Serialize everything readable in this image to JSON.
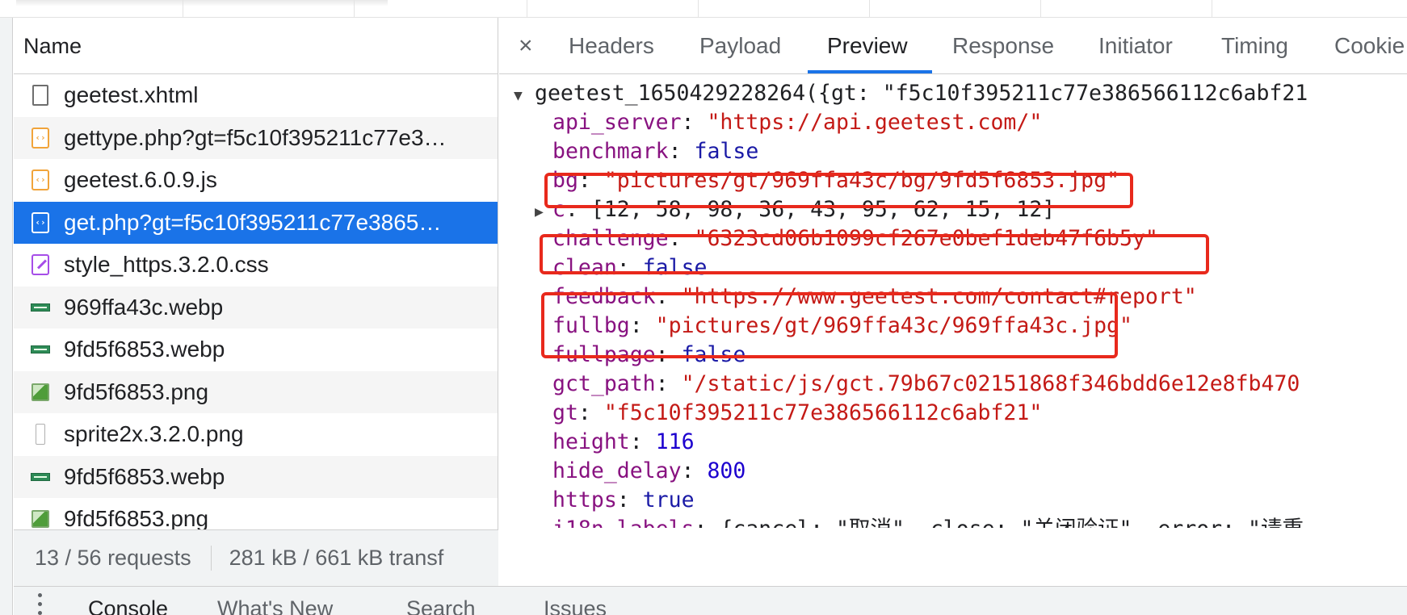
{
  "network": {
    "name_header": "Name",
    "requests": [
      {
        "name": "geetest.xhtml",
        "icon": "document-icon"
      },
      {
        "name": "gettype.php?gt=f5c10f395211c77e3…",
        "icon": "script-icon"
      },
      {
        "name": "geetest.6.0.9.js",
        "icon": "script-icon"
      },
      {
        "name": "get.php?gt=f5c10f395211c77e3865…",
        "icon": "script-icon"
      },
      {
        "name": "style_https.3.2.0.css",
        "icon": "stylesheet-icon"
      },
      {
        "name": "969ffa43c.webp",
        "icon": "webp-image-icon"
      },
      {
        "name": "9fd5f6853.webp",
        "icon": "webp-image-icon"
      },
      {
        "name": "9fd5f6853.png",
        "icon": "png-image-icon"
      },
      {
        "name": "sprite2x.3.2.0.png",
        "icon": "blank-file-icon"
      },
      {
        "name": "9fd5f6853.webp",
        "icon": "webp-image-icon"
      },
      {
        "name": "9fd5f6853.png",
        "icon": "png-image-icon"
      }
    ],
    "selected_index": 3,
    "status": {
      "requests": "13 / 56 requests",
      "transferred": "281 kB / 661 kB transf"
    }
  },
  "detail": {
    "close_symbol": "×",
    "tabs": [
      "Headers",
      "Payload",
      "Preview",
      "Response",
      "Initiator",
      "Timing",
      "Cookie"
    ],
    "active_tab": "Preview",
    "preview": {
      "root": "geetest_1650429228264({gt: \"f5c10f395211c77e386566112c6abf21",
      "lines": [
        {
          "key": "api_server",
          "value": "\"https://api.geetest.com/\"",
          "type": "string"
        },
        {
          "key": "benchmark",
          "value": "false",
          "type": "bool"
        },
        {
          "key": "bg",
          "value": "\"pictures/gt/969ffa43c/bg/9fd5f6853.jpg\"",
          "type": "string"
        },
        {
          "key": "c",
          "value": "[12, 58, 98, 36, 43, 95, 62, 15, 12]",
          "type": "array"
        },
        {
          "key": "challenge",
          "value": "\"6323cd06b1099cf267e0bef1deb47f6b5y\"",
          "type": "string"
        },
        {
          "key": "clean",
          "value": "false",
          "type": "bool"
        },
        {
          "key": "feedback",
          "value": "\"https://www.geetest.com/contact#report\"",
          "type": "string"
        },
        {
          "key": "fullbg",
          "value": "\"pictures/gt/969ffa43c/969ffa43c.jpg\"",
          "type": "string"
        },
        {
          "key": "fullpage",
          "value": "false",
          "type": "bool"
        },
        {
          "key": "gct_path",
          "value": "\"/static/js/gct.79b67c02151868f346bdd6e12e8fb470",
          "type": "string"
        },
        {
          "key": "gt",
          "value": "\"f5c10f395211c77e386566112c6abf21\"",
          "type": "string"
        },
        {
          "key": "height",
          "value": "116",
          "type": "number"
        },
        {
          "key": "hide_delay",
          "value": "800",
          "type": "number"
        },
        {
          "key": "https",
          "value": "true",
          "type": "bool"
        },
        {
          "key": "i18n_labels",
          "value": "{cancel: \"取消\", close: \"关闭验证\", error: \"请重",
          "type": "object"
        }
      ]
    }
  },
  "drawer": {
    "tabs": [
      "Console",
      "What's New",
      "Search",
      "Issues"
    ],
    "active_tab": "Console"
  },
  "colors": {
    "accent": "#1a73e8",
    "highlight_box": "#e8291c",
    "key": "#881280",
    "string": "#c41a16",
    "keyword": "#1a1aa6"
  }
}
